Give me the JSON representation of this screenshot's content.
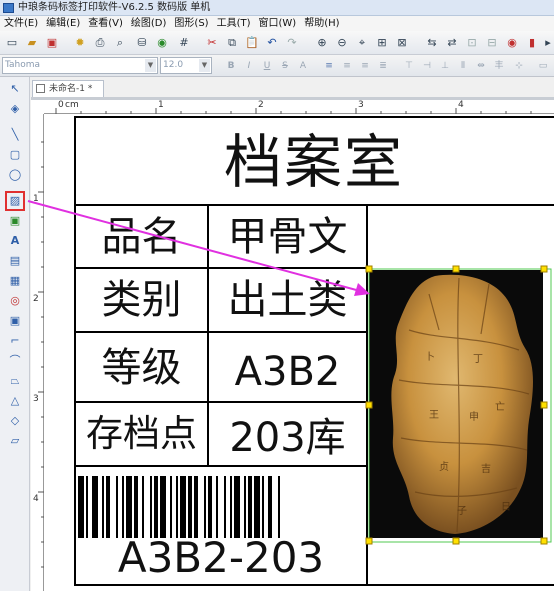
{
  "window": {
    "title": "中琅条码标签打印软件-V6.2.5 数码版 单机"
  },
  "menu": [
    "文件(E)",
    "编辑(E)",
    "查看(V)",
    "绘图(D)",
    "图形(S)",
    "工具(T)",
    "窗口(W)",
    "帮助(H)"
  ],
  "format_bar": {
    "font_value": "Tahoma",
    "size_value": "12.0"
  },
  "document": {
    "tab_label": "未命名-1 *"
  },
  "ruler": {
    "unit": "cm",
    "h_marks": [
      "0",
      "1",
      "2",
      "3",
      "4"
    ],
    "v_marks": [
      "1",
      "2",
      "3",
      "4"
    ]
  },
  "label": {
    "title": "档案室",
    "rows": [
      {
        "key": "品名",
        "value": "甲骨文"
      },
      {
        "key": "类别",
        "value": "出土类"
      },
      {
        "key": "等级",
        "value": "A3B2"
      },
      {
        "key": "存档点",
        "value": "203库"
      }
    ],
    "barcode_text": "A3B2-203",
    "image_name": "oracle-bone-photo"
  },
  "colors": {
    "arrow": "#e030e0",
    "selection": "#50c850",
    "handle": "#ffe000"
  }
}
